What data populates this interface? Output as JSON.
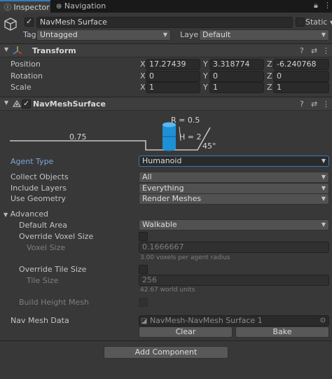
{
  "tabs": [
    {
      "label": "Inspector"
    },
    {
      "label": "Navigation"
    }
  ],
  "object": {
    "name": "NavMesh Surface",
    "static_label": "Static",
    "tag_label": "Tag",
    "tag_value": "Untagged",
    "layer_label": "Layer",
    "layer_value": "Default"
  },
  "transform": {
    "title": "Transform",
    "position": {
      "label": "Position",
      "x": "17.27439",
      "y": "3.318774",
      "z": "-6.240768"
    },
    "rotation": {
      "label": "Rotation",
      "x": "0",
      "y": "0",
      "z": "0"
    },
    "scale": {
      "label": "Scale",
      "x": "1",
      "y": "1",
      "z": "1"
    }
  },
  "axis": {
    "x": "X",
    "y": "Y",
    "z": "Z"
  },
  "navmesh": {
    "title": "NavMeshSurface",
    "diagram": {
      "radius": "R = 0.5",
      "height": "H = 2",
      "step": "0.75",
      "slope": "45°"
    },
    "agent_type": {
      "label": "Agent Type",
      "value": "Humanoid"
    },
    "collect_objects": {
      "label": "Collect Objects",
      "value": "All"
    },
    "include_layers": {
      "label": "Include Layers",
      "value": "Everything"
    },
    "use_geometry": {
      "label": "Use Geometry",
      "value": "Render Meshes"
    },
    "advanced": {
      "label": "Advanced",
      "default_area": {
        "label": "Default Area",
        "value": "Walkable"
      },
      "override_voxel": {
        "label": "Override Voxel Size"
      },
      "voxel_size": {
        "label": "Voxel Size",
        "value": "0.1666667",
        "hint": "3.00 voxels per agent radius"
      },
      "override_tile": {
        "label": "Override Tile Size"
      },
      "tile_size": {
        "label": "Tile Size",
        "value": "256",
        "hint": "42.67 world units"
      },
      "build_height": {
        "label": "Build Height Mesh"
      }
    },
    "nav_mesh_data": {
      "label": "Nav Mesh Data",
      "value": "NavMesh-NavMesh Surface 1"
    },
    "clear_button": "Clear",
    "bake_button": "Bake"
  },
  "add_component": "Add Component",
  "colors": {
    "accent": "#3a79bb",
    "capsule": "#1e90d6",
    "background": "#383838"
  }
}
